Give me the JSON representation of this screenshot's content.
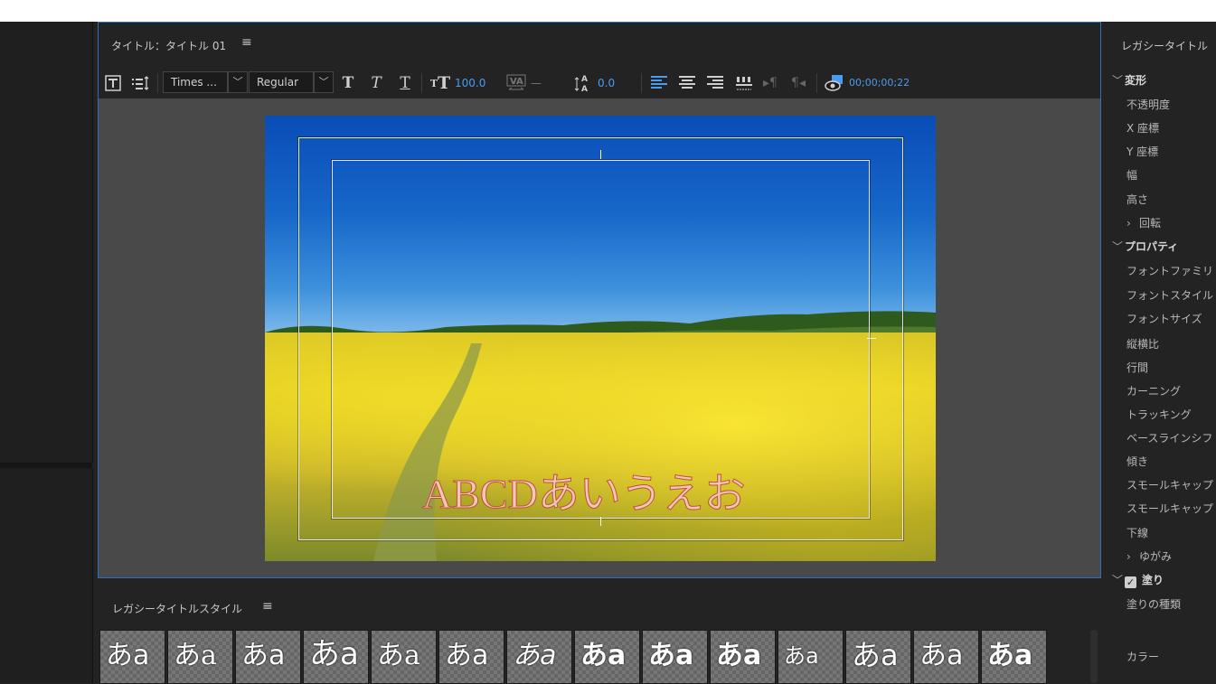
{
  "title_panel": {
    "title": "タイトル：タイトル 01",
    "menu_icon": "≡"
  },
  "toolbar": {
    "font_family": "Times ...",
    "font_style": "Regular",
    "font_size": "100.0",
    "kerning": "—",
    "baseline": "0.0",
    "timecode": "00;00;00;22",
    "icons": [
      "title-type-icon",
      "roll-crawl-icon",
      "bold-icon",
      "italic-icon",
      "underline-icon",
      "font-size-icon",
      "kerning-icon",
      "leading-icon",
      "align-left-icon",
      "align-center-icon",
      "align-right-icon",
      "tab-stops-icon",
      "show-background-video-icon"
    ]
  },
  "canvas": {
    "title_text": "ABCDあいうえお",
    "text_fill": "#f1c8b8",
    "text_stroke": "#c0503a"
  },
  "styles_panel": {
    "title": "レガシータイトルスタイル",
    "menu_icon": "≡",
    "swatches": [
      "あa",
      "あa",
      "あa",
      "あa",
      "あa",
      "あa",
      "あa",
      "あa",
      "あa",
      "あa",
      "あa",
      "あa",
      "あa",
      "あa"
    ]
  },
  "properties": {
    "title": "レガシータイトル",
    "transform": {
      "label": "変形",
      "items": [
        "不透明度",
        "X 座標",
        "Y 座標",
        "幅",
        "高さ"
      ],
      "rotate": "回転"
    },
    "props": {
      "label": "プロパティ",
      "items": [
        "フォントファミリ",
        "フォントスタイル",
        "フォントサイズ",
        "縦横比",
        "行間",
        "カーニング",
        "トラッキング",
        "ベースラインシフ",
        "傾き",
        "スモールキャップ",
        "スモールキャップ",
        "下線"
      ],
      "distort": "ゆがみ"
    },
    "fill": {
      "label": "塗り",
      "checked": true,
      "type_label": "塗りの種類",
      "color_label": "カラー"
    }
  },
  "colors": {
    "accent": "#4a9cf0",
    "panel_border": "#2f6fb9"
  }
}
